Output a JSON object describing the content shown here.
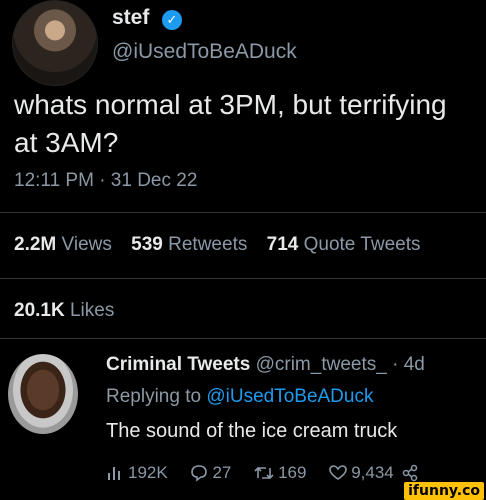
{
  "tweet": {
    "author_name": "stef",
    "author_handle": "@iUsedToBeADuck",
    "text": "whats normal at 3PM, but terrifying at 3AM?",
    "timestamp": "12:11 PM · 31 Dec 22",
    "stats": {
      "views_count": "2.2M",
      "views_label": "Views",
      "retweets_count": "539",
      "retweets_label": "Retweets",
      "quotes_count": "714",
      "quotes_label": "Quote Tweets",
      "likes_count": "20.1K",
      "likes_label": "Likes"
    }
  },
  "reply": {
    "author_name": "Criminal Tweets",
    "author_handle": "@crim_tweets_",
    "age": "· 4d",
    "replying_prefix": "Replying to",
    "replying_to": "@iUsedToBeADuck",
    "text": "The sound of the ice cream truck",
    "views": "192K",
    "replies": "27",
    "retweets": "169",
    "likes": "9,434"
  },
  "watermark": "ifunny.co",
  "colors": {
    "background": "#000000",
    "text": "#e7e9ea",
    "muted": "#8b98a5",
    "accent": "#1d9bf0",
    "verified": "#1d9bf0"
  },
  "icons": [
    "verified-badge-icon",
    "views-icon",
    "reply-icon",
    "retweet-icon",
    "like-icon",
    "share-icon"
  ]
}
